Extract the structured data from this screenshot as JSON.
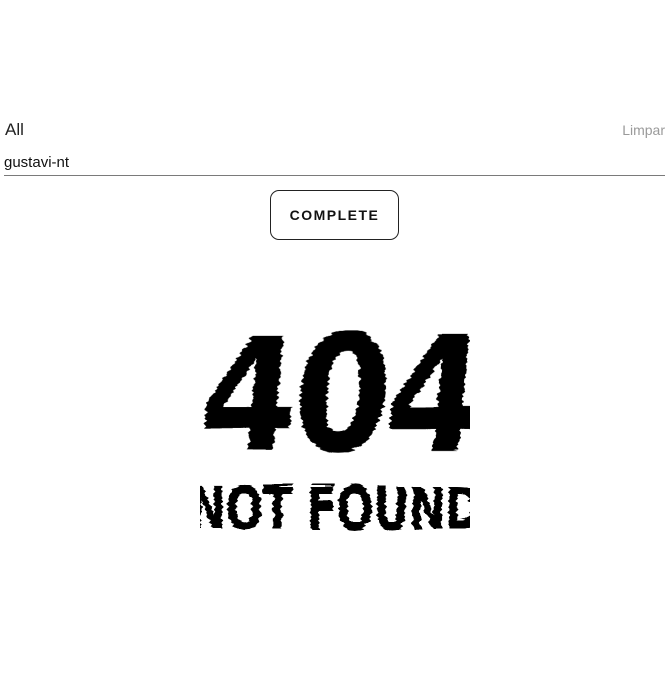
{
  "filter": {
    "label": "All",
    "clear_label": "Limpar"
  },
  "search": {
    "value": "gustavi-nt",
    "placeholder": ""
  },
  "actions": {
    "complete_label": "COMPLETE"
  },
  "illustration": {
    "code": "404",
    "message": "NOT FOUND",
    "icon": "glitch-404-not-found",
    "color": "#000000"
  }
}
